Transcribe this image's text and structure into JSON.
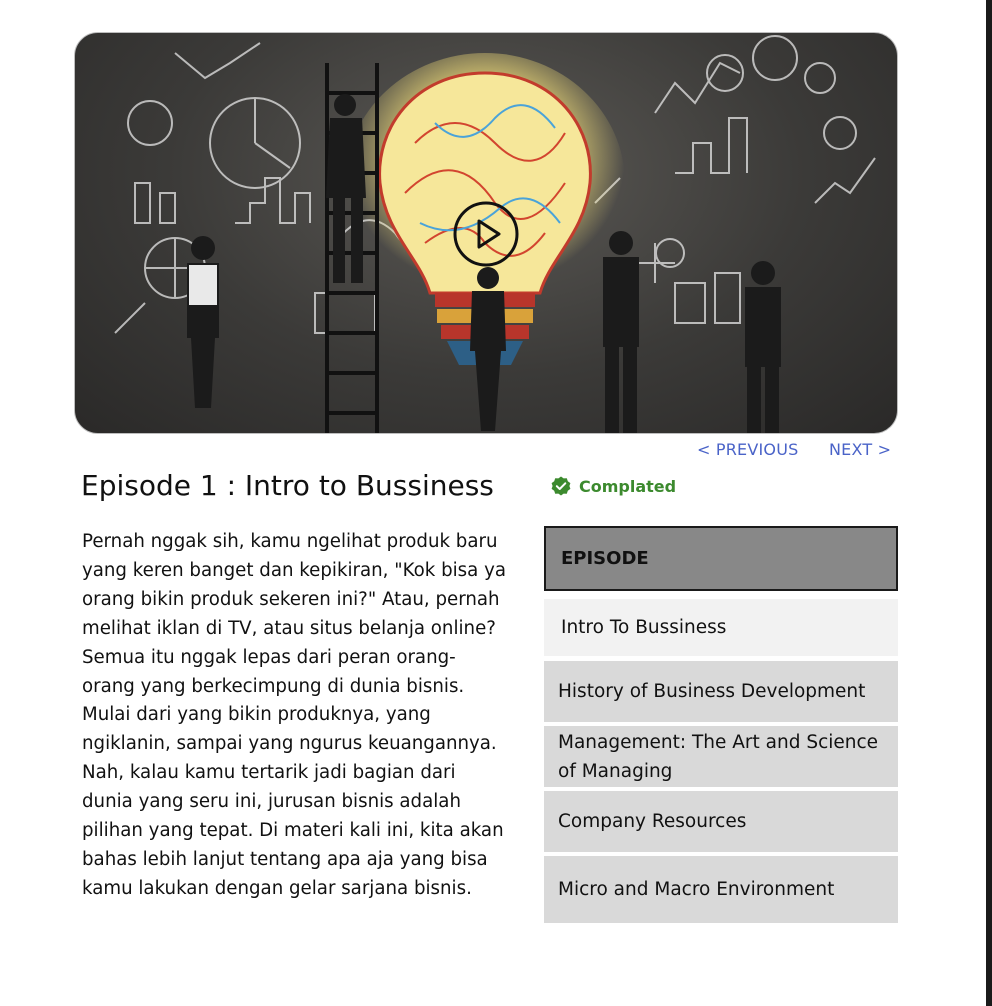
{
  "video": {
    "description": "business lightbulb illustration",
    "play_icon": "play-circle-icon"
  },
  "nav": {
    "previous_label": "< PREVIOUS",
    "next_label": "NEXT >"
  },
  "episode": {
    "title": "Episode 1 : Intro to Bussiness",
    "status": "Complated",
    "status_icon": "check-badge-icon",
    "status_color": "#3c8a2e",
    "description": "Pernah nggak sih, kamu ngelihat produk baru yang keren banget dan kepikiran, \"Kok bisa ya orang bikin produk sekeren ini?\" Atau, pernah melihat iklan di TV, atau situs belanja online? Semua itu nggak lepas dari peran orang-orang yang berkecimpung di dunia bisnis. Mulai dari yang bikin produknya, yang ngiklanin, sampai yang ngurus keuangannya. Nah, kalau kamu tertarik jadi bagian dari dunia yang seru ini, jurusan bisnis adalah pilihan yang tepat. Di materi kali ini, kita akan bahas lebih lanjut tentang apa aja yang bisa kamu lakukan dengan gelar sarjana bisnis."
  },
  "episode_list": {
    "header": "EPISODE",
    "items": [
      {
        "label": "Intro To Bussiness"
      },
      {
        "label": "History of Business Development"
      },
      {
        "label": "Management: The Art and Science of Managing"
      },
      {
        "label": "Company Resources"
      },
      {
        "label": "Micro and Macro Environment"
      }
    ]
  },
  "colors": {
    "link": "#4a63c8",
    "header_bg": "#888888",
    "item_bg": "#d9d9d9",
    "active_item_bg": "#f2f2f2"
  }
}
